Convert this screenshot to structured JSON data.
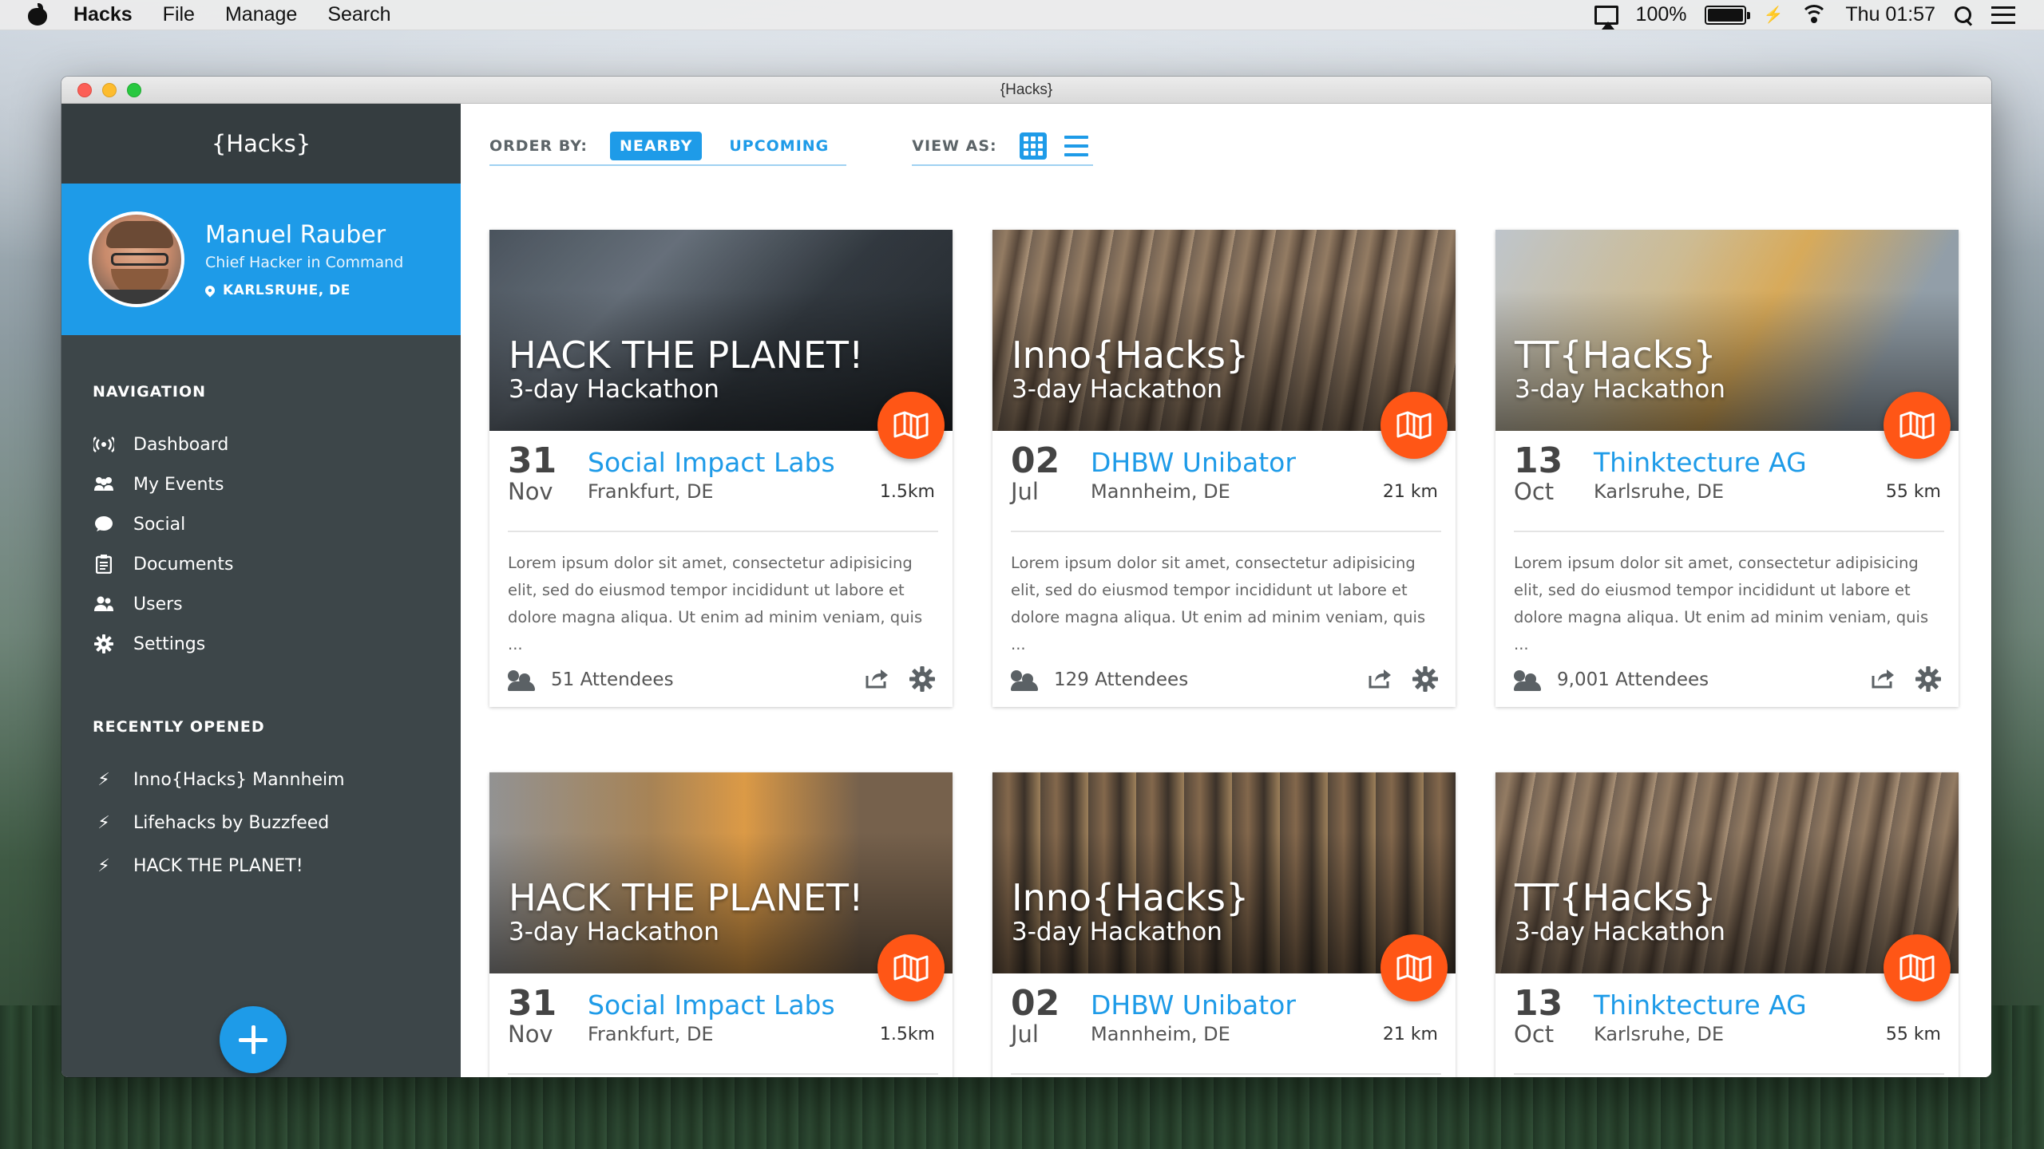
{
  "menubar": {
    "app_name": "Hacks",
    "menus": [
      "File",
      "Manage",
      "Search"
    ],
    "battery": "100%",
    "clock": "Thu 01:57"
  },
  "window": {
    "title": "{Hacks}"
  },
  "sidebar": {
    "brand": "{Hacks}",
    "profile": {
      "name": "Manuel Rauber",
      "role": "Chief Hacker in Command",
      "location": "KARLSRUHE, DE"
    },
    "nav_title": "NAVIGATION",
    "nav_items": [
      {
        "label": "Dashboard",
        "icon": "broadcast-icon"
      },
      {
        "label": "My Events",
        "icon": "group-icon"
      },
      {
        "label": "Social",
        "icon": "chat-bubble-icon"
      },
      {
        "label": "Documents",
        "icon": "clipboard-icon"
      },
      {
        "label": "Users",
        "icon": "users-icon"
      },
      {
        "label": "Settings",
        "icon": "gear-icon"
      }
    ],
    "recent_title": "RECENTLY OPENED",
    "recent_items": [
      {
        "label": "Inno{Hacks} Mannheim"
      },
      {
        "label": "Lifehacks by Buzzfeed"
      },
      {
        "label": "HACK THE PLANET!"
      }
    ],
    "fab_icon": "plus-icon"
  },
  "toolbar": {
    "order_label": "ORDER BY:",
    "order_options": [
      "NEARBY",
      "UPCOMING"
    ],
    "order_selected": "NEARBY",
    "view_label": "VIEW AS:",
    "view_selected": "grid"
  },
  "colors": {
    "accent": "#1e9be8",
    "sidebar_bg": "#3d4649",
    "map_button": "#ff5616"
  },
  "cards": [
    {
      "title": "HACK THE PLANET!",
      "subtitle": "3-day Hackathon",
      "day": "31",
      "month": "Nov",
      "org": "Social Impact Labs",
      "city": "Frankfurt, DE",
      "distance": "1.5km",
      "description": "Lorem ipsum dolor sit amet, consectetur adipisicing elit, sed do eiusmod tempor incididunt ut labore et dolore magna aliqua. Ut enim ad minim veniam, quis ...",
      "attendees": "51 Attendees"
    },
    {
      "title": "Inno{Hacks}",
      "subtitle": "3-day Hackathon",
      "day": "02",
      "month": "Jul",
      "org": "DHBW Unibator",
      "city": "Mannheim, DE",
      "distance": "21 km",
      "description": "Lorem ipsum dolor sit amet, consectetur adipisicing elit, sed do eiusmod tempor incididunt ut labore et dolore magna aliqua. Ut enim ad minim veniam, quis ...",
      "attendees": "129 Attendees"
    },
    {
      "title": "TT{Hacks}",
      "subtitle": "3-day Hackathon",
      "day": "13",
      "month": "Oct",
      "org": "Thinktecture AG",
      "city": "Karlsruhe, DE",
      "distance": "55 km",
      "description": "Lorem ipsum dolor sit amet, consectetur adipisicing elit, sed do eiusmod tempor incididunt ut labore et dolore magna aliqua. Ut enim ad minim veniam, quis ...",
      "attendees": "9,001 Attendees"
    },
    {
      "title": "HACK THE PLANET!",
      "subtitle": "3-day Hackathon",
      "day": "31",
      "month": "Nov",
      "org": "Social Impact Labs",
      "city": "Frankfurt, DE",
      "distance": "1.5km"
    },
    {
      "title": "Inno{Hacks}",
      "subtitle": "3-day Hackathon",
      "day": "02",
      "month": "Jul",
      "org": "DHBW Unibator",
      "city": "Mannheim, DE",
      "distance": "21 km"
    },
    {
      "title": "TT{Hacks}",
      "subtitle": "3-day Hackathon",
      "day": "13",
      "month": "Oct",
      "org": "Thinktecture AG",
      "city": "Karlsruhe, DE",
      "distance": "55 km"
    }
  ]
}
